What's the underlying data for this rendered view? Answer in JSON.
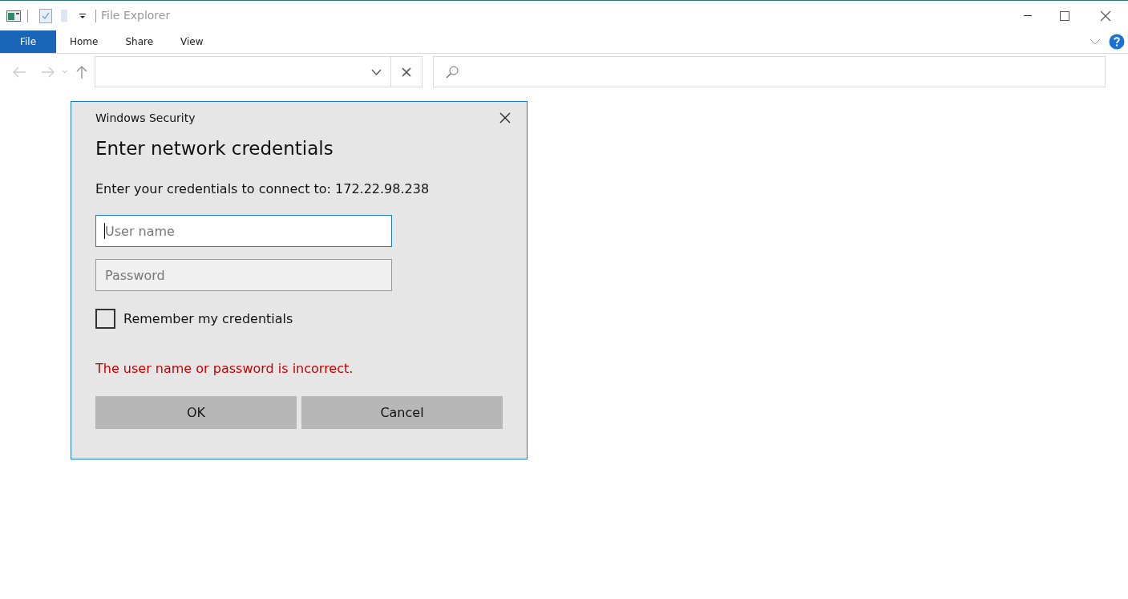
{
  "window": {
    "title": "File Explorer"
  },
  "ribbon_tabs": [
    {
      "label": "File",
      "selected": true
    },
    {
      "label": "Home",
      "selected": false
    },
    {
      "label": "Share",
      "selected": false
    },
    {
      "label": "View",
      "selected": false
    }
  ],
  "dialog": {
    "caption": "Windows Security",
    "heading": "Enter network credentials",
    "message": "Enter your credentials to connect to: 172.22.98.238",
    "fields": [
      {
        "placeholder": "User name",
        "focused": true
      },
      {
        "placeholder": "Password",
        "focused": false
      }
    ],
    "remember": {
      "label": "Remember my credentials",
      "checked": false
    },
    "error": "The user name or password is incorrect.",
    "buttons": [
      "OK",
      "Cancel"
    ]
  }
}
